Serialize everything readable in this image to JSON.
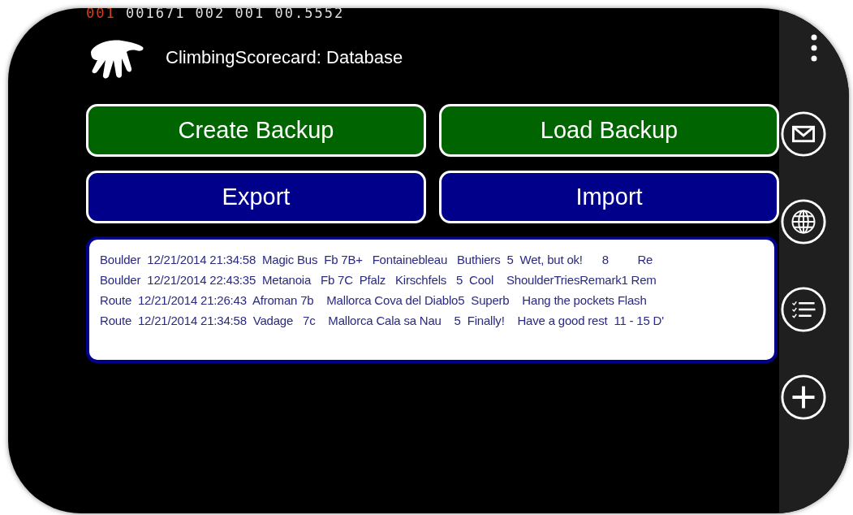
{
  "debug_counter": {
    "highlight": "001",
    "rest": "001671 002 001 00.5552"
  },
  "app_title": "ClimbingScorecard: Database",
  "buttons": [
    {
      "label": "Create Backup",
      "kind": "backup"
    },
    {
      "label": "Load Backup",
      "kind": "backup"
    },
    {
      "label": "Export",
      "kind": "transfer"
    },
    {
      "label": "Import",
      "kind": "transfer"
    }
  ],
  "records": [
    "Boulder  12/21/2014 21:34:58  Magic Bus  Fb 7B+   Fontainebleau   Buthiers  5  Wet, but ok!      8         Re",
    "Boulder  12/21/2014 22:43:35  Metanoia   Fb 7C  Pfalz   Kirschfels   5  Cool    ShoulderTriesRemark1 Rem",
    "Route  12/21/2014 21:26:43  Afroman 7b    Mallorca Cova del Diablo5  Superb    Hang the pockets Flash",
    "Route  12/21/2014 21:34:58  Vadage   7c    Mallorca Cala sa Nau    5  Finally!    Have a good rest  11 - 15 D'"
  ]
}
